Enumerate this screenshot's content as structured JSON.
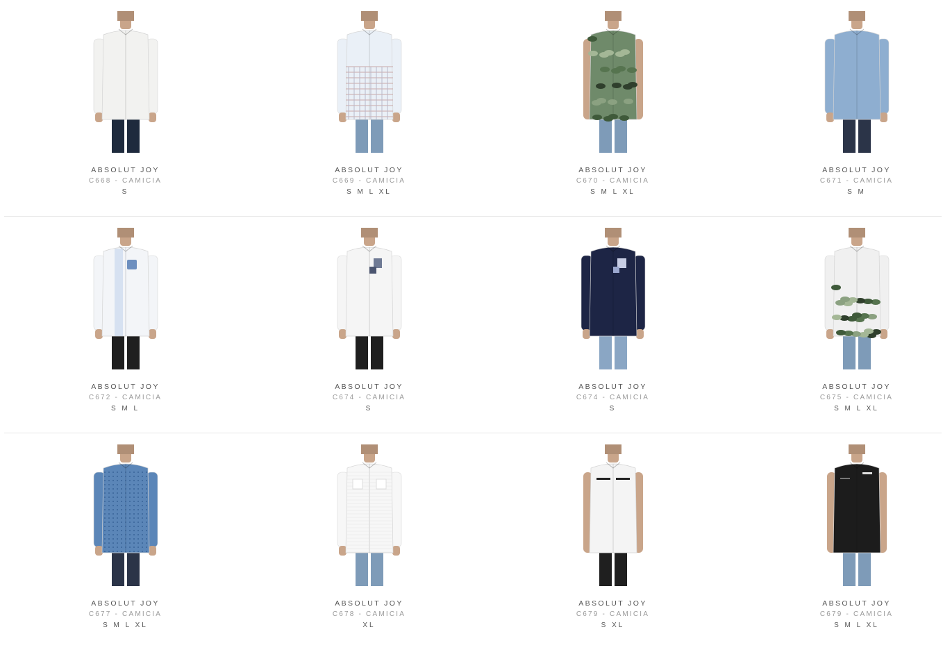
{
  "products": [
    {
      "brand": "ABSOLUT JOY",
      "code": "C668 - CAMICIA",
      "sizes": "S",
      "shirt_color": "#f2f2f0",
      "pants_color": "#1e2a3d",
      "sleeves": true,
      "pattern": "plain"
    },
    {
      "brand": "ABSOLUT JOY",
      "code": "C669 - CAMICIA",
      "sizes": "S M L XL",
      "shirt_color": "#eaf0f7",
      "pants_color": "#7e9bb8",
      "sleeves": true,
      "pattern": "check"
    },
    {
      "brand": "ABSOLUT JOY",
      "code": "C670 - CAMICIA",
      "sizes": "S M L XL",
      "shirt_color": "#6f8a6a",
      "pants_color": "#7e9bb8",
      "sleeves": false,
      "pattern": "camo"
    },
    {
      "brand": "ABSOLUT JOY",
      "code": "C671 - CAMICIA",
      "sizes": "S M",
      "shirt_color": "#8eaed0",
      "pants_color": "#2b3448",
      "sleeves": true,
      "pattern": "plain"
    },
    {
      "brand": "ABSOLUT JOY",
      "code": "C672 - CAMICIA",
      "sizes": "S M L",
      "shirt_color": "#f3f5f8",
      "pants_color": "#1f1f1f",
      "sleeves": true,
      "pattern": "pocket-blue"
    },
    {
      "brand": "ABSOLUT JOY",
      "code": "C674 - CAMICIA",
      "sizes": "S",
      "shirt_color": "#f5f5f5",
      "pants_color": "#1f1f1f",
      "sleeves": true,
      "pattern": "pocket-grey"
    },
    {
      "brand": "ABSOLUT JOY",
      "code": "C674 - CAMICIA",
      "sizes": "S",
      "shirt_color": "#1d2545",
      "pants_color": "#8aa6c4",
      "sleeves": true,
      "pattern": "pocket-light"
    },
    {
      "brand": "ABSOLUT JOY",
      "code": "C675 - CAMICIA",
      "sizes": "S M L XL",
      "shirt_color": "#f0f0f0",
      "pants_color": "#7e9bb8",
      "sleeves": true,
      "pattern": "camo-bottom"
    },
    {
      "brand": "ABSOLUT JOY",
      "code": "C677 - CAMICIA",
      "sizes": "S M L XL",
      "shirt_color": "#5b86b8",
      "pants_color": "#2b3448",
      "sleeves": true,
      "pattern": "dots"
    },
    {
      "brand": "ABSOLUT JOY",
      "code": "C678 - CAMICIA",
      "sizes": "XL",
      "shirt_color": "#f7f7f7",
      "pants_color": "#7e9bb8",
      "sleeves": true,
      "pattern": "mesh"
    },
    {
      "brand": "ABSOLUT JOY",
      "code": "C679 - CAMICIA",
      "sizes": "S XL",
      "shirt_color": "#f4f4f4",
      "pants_color": "#1f1f1f",
      "sleeves": false,
      "pattern": "zips"
    },
    {
      "brand": "ABSOLUT JOY",
      "code": "C679 - CAMICIA",
      "sizes": "S M L XL",
      "shirt_color": "#1c1c1c",
      "pants_color": "#7e9bb8",
      "sleeves": false,
      "pattern": "zips-dark"
    }
  ]
}
